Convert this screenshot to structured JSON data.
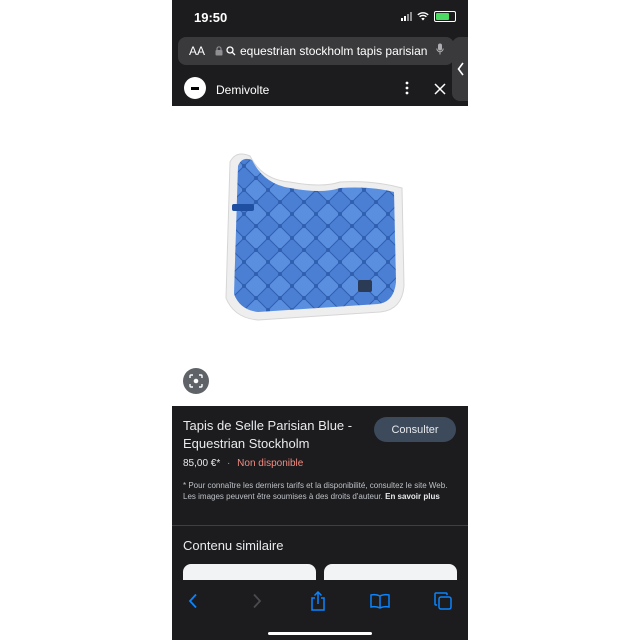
{
  "status_bar": {
    "time": "19:50"
  },
  "url_bar": {
    "aa": "AA",
    "url": "equestrian stockholm tapis parisian"
  },
  "source": {
    "name": "Demivolte"
  },
  "product": {
    "title": "Tapis de Selle Parisian Blue - Equestrian Stockholm",
    "button": "Consulter",
    "price": "85,00 €*",
    "separator": "·",
    "availability": "Non disponible",
    "disclaimer": "* Pour connaître les derniers tarifs et la disponibilité, consultez le site Web. Les images peuvent être soumises à des droits d'auteur.",
    "learn_more": "En savoir plus"
  },
  "similar": {
    "heading": "Contenu similaire"
  },
  "colors": {
    "pad_blue": "#4a7fd4",
    "trim": "#f2f2f2",
    "accent_red": "#f28b82",
    "button_bg": "#3c4a5c",
    "ios_blue": "#0a84ff"
  },
  "icons": [
    "lock-icon",
    "microphone-icon",
    "more-vert-icon",
    "close-icon",
    "lens-icon",
    "back-icon",
    "forward-icon",
    "share-icon",
    "bookmarks-icon",
    "tabs-icon"
  ]
}
